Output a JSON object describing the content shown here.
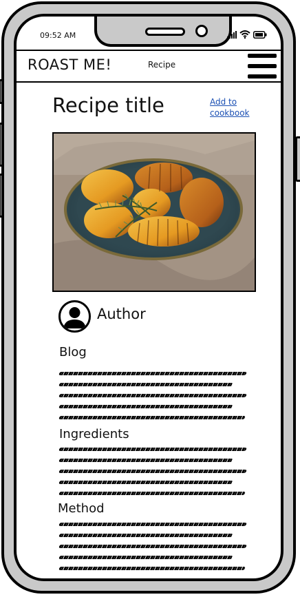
{
  "status_bar": {
    "time": "09:52 AM",
    "icons": [
      "signal-icon",
      "wifi-icon",
      "battery-icon"
    ]
  },
  "header": {
    "brand": "ROAST ME!",
    "nav_label": "Recipe",
    "menu_icon": "hamburger-menu-icon"
  },
  "recipe": {
    "title": "Recipe title",
    "add_to_cookbook": "Add to cookbook",
    "image_icon": "roast-potatoes-photo"
  },
  "author": {
    "name": "Author",
    "avatar_icon": "user-avatar-icon"
  },
  "sections": {
    "blog": "Blog",
    "ingredients": "Ingredients",
    "method": "Method"
  },
  "colors": {
    "link": "#1a4fb3",
    "frame": "#c9c9c9",
    "ink": "#000000"
  }
}
